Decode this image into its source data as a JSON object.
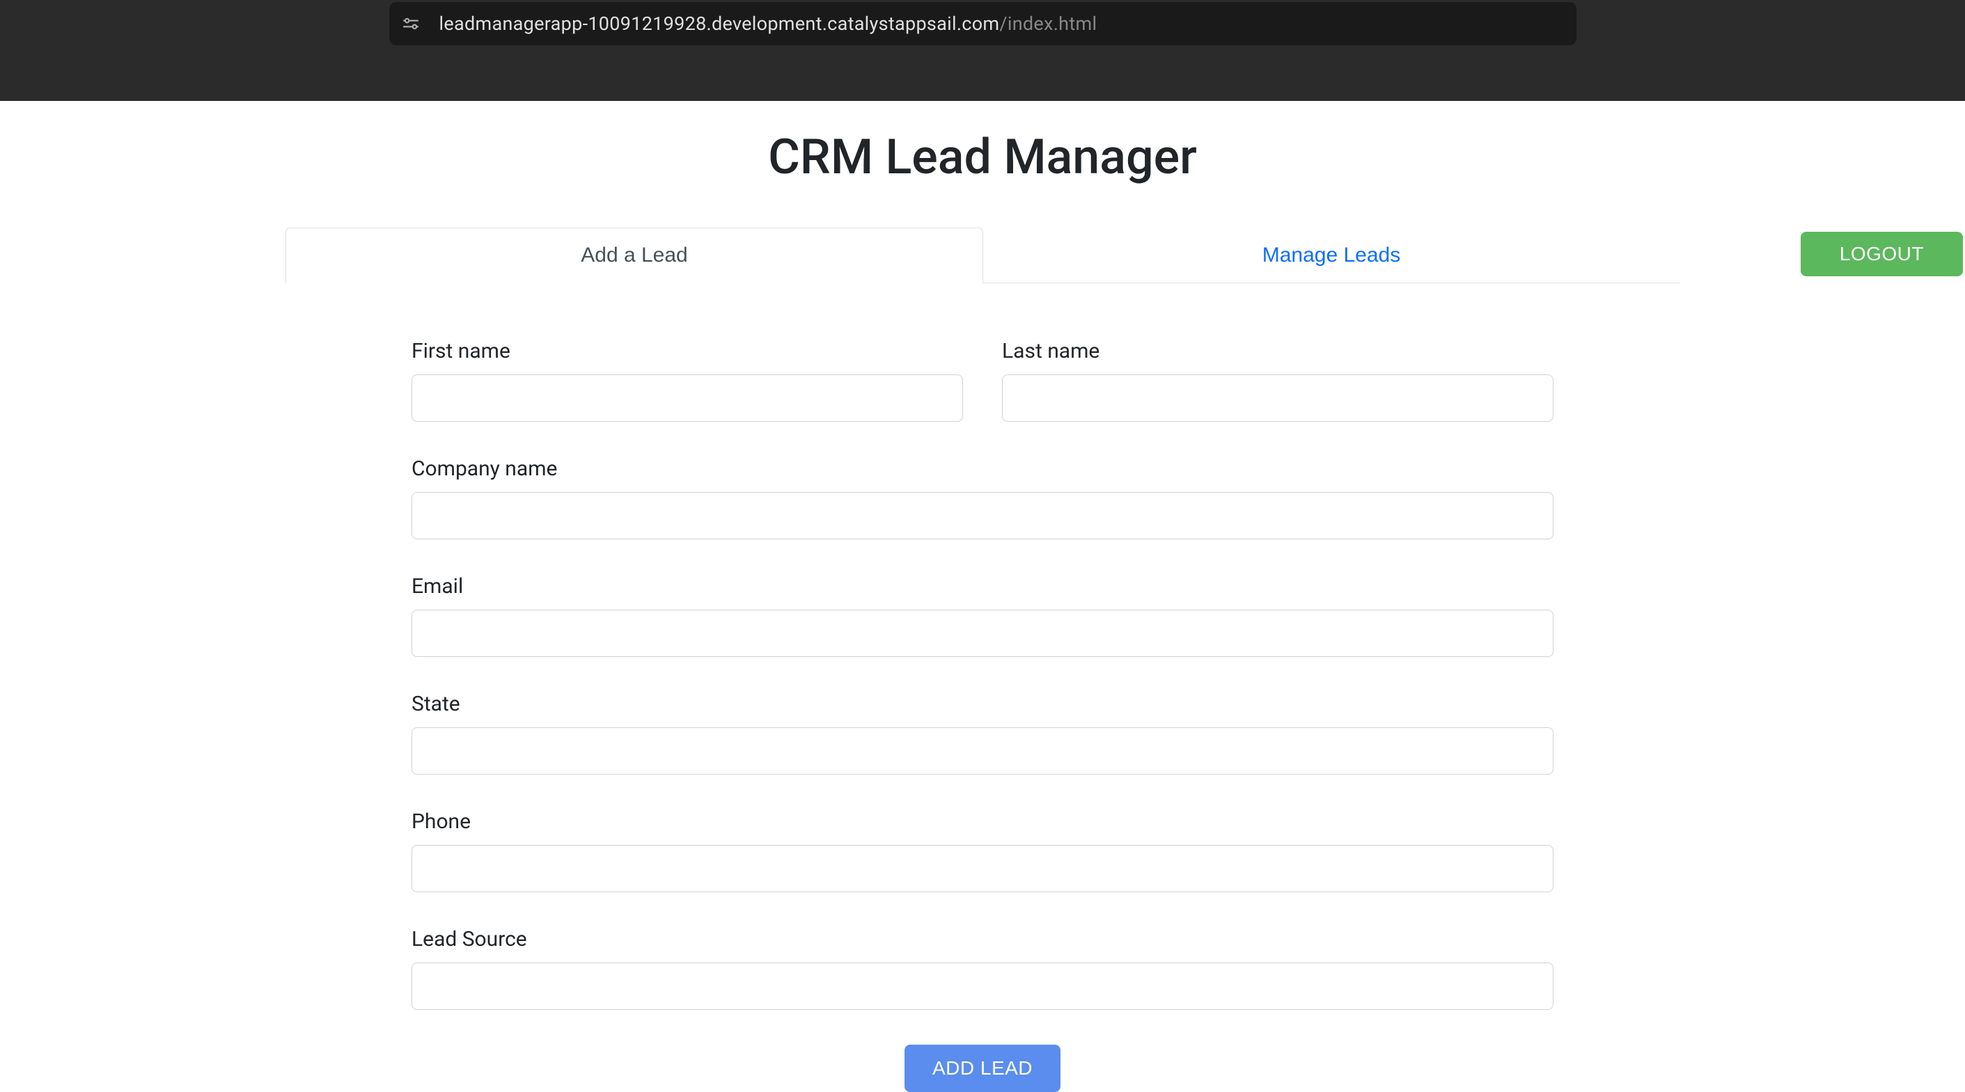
{
  "browser": {
    "url_domain": "leadmanagerapp-10091219928.development.catalystappsail.com",
    "url_path": "/index.html"
  },
  "header": {
    "title": "CRM Lead Manager",
    "logout_label": "LOGOUT"
  },
  "tabs": {
    "add_lead": "Add a Lead",
    "manage_leads": "Manage Leads"
  },
  "form": {
    "first_name_label": "First name",
    "first_name_value": "",
    "last_name_label": "Last name",
    "last_name_value": "",
    "company_name_label": "Company name",
    "company_name_value": "",
    "email_label": "Email",
    "email_value": "",
    "state_label": "State",
    "state_value": "",
    "phone_label": "Phone",
    "phone_value": "",
    "lead_source_label": "Lead Source",
    "lead_source_value": "",
    "submit_label": "ADD LEAD"
  }
}
